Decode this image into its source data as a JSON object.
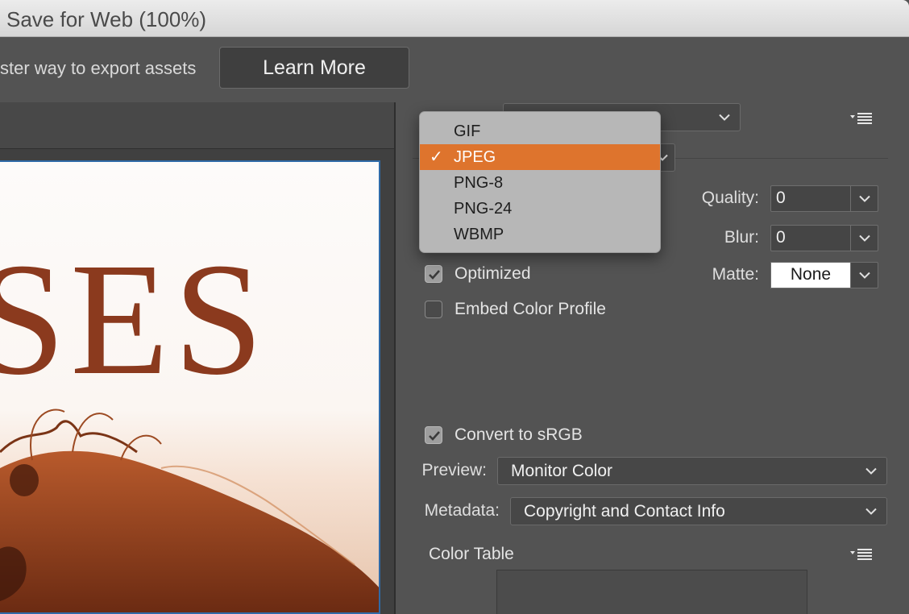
{
  "window": {
    "title": "Save for Web (100%)"
  },
  "promo": {
    "text": "ster way to export assets",
    "learn_more_label": "Learn More"
  },
  "preview": {
    "image_text": "SES"
  },
  "settings": {
    "preset_menu_icon": "flyout-menu-icon",
    "quality_label": "Quality:",
    "quality_value": "0",
    "blur_label": "Blur:",
    "blur_value": "0",
    "matte_label": "Matte:",
    "matte_value": "None",
    "optimized_label": "Optimized",
    "optimized_checked": true,
    "embed_profile_label": "Embed Color Profile",
    "embed_profile_checked": false,
    "convert_srgb_label": "Convert to sRGB",
    "convert_srgb_checked": true,
    "preview_label": "Preview:",
    "preview_value": "Monitor Color",
    "metadata_label": "Metadata:",
    "metadata_value": "Copyright and Contact Info",
    "color_table_label": "Color Table"
  },
  "format_menu": {
    "items": [
      {
        "label": "GIF",
        "selected": false
      },
      {
        "label": "JPEG",
        "selected": true
      },
      {
        "label": "PNG-8",
        "selected": false
      },
      {
        "label": "PNG-24",
        "selected": false
      },
      {
        "label": "WBMP",
        "selected": false
      }
    ],
    "checkmark": "✓"
  },
  "colors": {
    "accent": "#de742d",
    "panel": "#535353",
    "preview_border": "#2f6aa8",
    "title_text": "#8b3a1e"
  }
}
